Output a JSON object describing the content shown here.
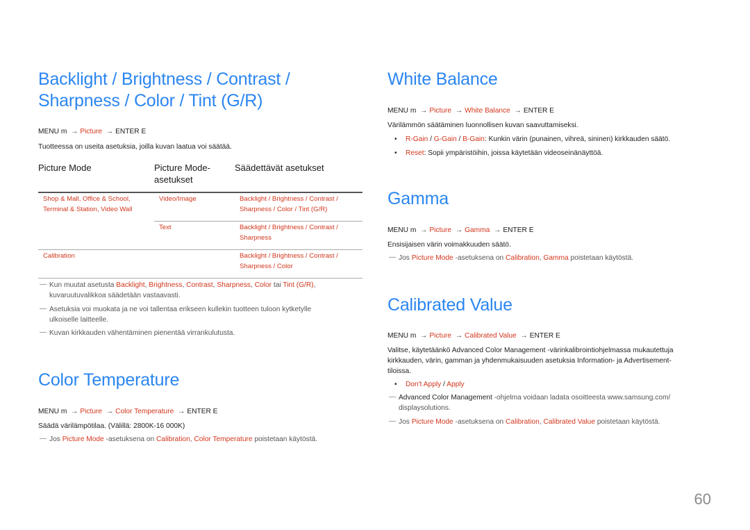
{
  "page_number": "60",
  "colors": {
    "heading": "#2b86f0",
    "accent": "#d2361c",
    "text": "#222222",
    "note": "#555555"
  },
  "left": {
    "backlight_section": {
      "title_line1": "Backlight / Brightness / Contrast /",
      "title_line2": "Sharpness / Color / Tint (G/R)",
      "menu": {
        "prefix": "MENU m",
        "items": [
          "Picture"
        ],
        "suffix": "ENTER E"
      },
      "description": "Tuotteessa on useita asetuksia, joilla kuvan laatua voi säätää.",
      "table": {
        "headers": [
          "Picture Mode",
          "Picture Mode-",
          "asetukset",
          "Säädettävät asetukset"
        ],
        "rows": [
          {
            "mode_line1": "Shop & Mall, Office & School,",
            "mode_line2": "Terminal & Station, Video Wall",
            "setting": "Video/Image",
            "adjust_line1": "Backlight / Brightness / Contrast /",
            "adjust_line2": "Sharpness / Color / Tint (G/R)"
          },
          {
            "mode_line1": "",
            "mode_line2": "",
            "setting": "Text",
            "adjust_line1": "Backlight / Brightness / Contrast /",
            "adjust_line2": "Sharpness"
          },
          {
            "mode_line1": "Calibration",
            "mode_line2": "",
            "setting": "",
            "adjust_line1": "Backlight / Brightness / Contrast /",
            "adjust_line2": "Sharpness / Color"
          }
        ]
      },
      "notes": [
        {
          "pre": "Kun muutat asetusta ",
          "terms": [
            "Backlight",
            "Brightness",
            "Contrast",
            "Sharpness",
            "Color"
          ],
          "mid": " tai ",
          "last": "Tint (G/R)",
          "post": ",",
          "line2": "kuvaruutuvalikkoa säädetään vastaavasti."
        },
        {
          "line1": "Asetuksia voi muokata ja ne voi tallentaa erikseen kullekin tuotteen tuloon kytketylle",
          "line2": "ulkoiselle laitteelle."
        },
        {
          "line1": "Kuvan kirkkauden vähentäminen pienentää virrankulutusta."
        }
      ]
    },
    "color_temperature": {
      "title": "Color Temperature",
      "menu": {
        "prefix": "MENU m",
        "items": [
          "Picture",
          "Color Temperature"
        ],
        "suffix": "ENTER E"
      },
      "description": "Säädä värilämpötilaa. (Välillä: 2800K-16 000K)",
      "note": {
        "pre": "Jos ",
        "term1": "Picture Mode",
        "mid": " -asetuksena on ",
        "term2": "Calibration",
        "comma": ", ",
        "term3": "Color Temperature",
        "post": " poistetaan käytöstä."
      }
    }
  },
  "right": {
    "white_balance": {
      "title": "White Balance",
      "menu": {
        "prefix": "MENU m",
        "items": [
          "Picture",
          "White Balance"
        ],
        "suffix": "ENTER E"
      },
      "description": "Värilämmön säätäminen luonnollisen kuvan saavuttamiseksi.",
      "bullets": [
        {
          "terms": [
            "R-Gain",
            "G-Gain",
            "B-Gain"
          ],
          "text": ": Kunkin värin (punainen, vihreä, sininen) kirkkauden säätö."
        },
        {
          "terms": [
            "Reset"
          ],
          "text": ": Sopii ympäristöihin, joissa käytetään videoseinänäyttöä."
        }
      ]
    },
    "gamma": {
      "title": "Gamma",
      "menu": {
        "prefix": "MENU m",
        "items": [
          "Picture",
          "Gamma"
        ],
        "suffix": "ENTER E"
      },
      "description": "Ensisijaisen värin voimakkuuden säätö.",
      "note": {
        "pre": "Jos ",
        "term1": "Picture Mode",
        "mid": " -asetuksena on ",
        "term2": "Calibration",
        "comma": ", ",
        "term3": "Gamma",
        "post": " poistetaan käytöstä."
      }
    },
    "calibrated_value": {
      "title": "Calibrated Value",
      "menu": {
        "prefix": "MENU m",
        "items": [
          "Picture",
          "Calibrated Value"
        ],
        "suffix": "ENTER E"
      },
      "desc_pre": "Valitse, käytetäänkö ",
      "desc_term": "Advanced Color Management",
      "desc_post": " -värinkalibrointiohjelmassa mukautettuja",
      "desc_line2": "kirkkauden, värin, gamman ja yhdenmukaisuuden asetuksia Information- ja Advertisement-",
      "desc_line3": "tiloissa.",
      "options": [
        "Don't Apply",
        "Apply"
      ],
      "note1": {
        "term": "Advanced Color Management",
        "line1": " -ohjelma voidaan ladata osoitteesta www.samsung.com/",
        "line2": "displaysolutions."
      },
      "note2": {
        "pre": "Jos ",
        "term1": "Picture Mode",
        "mid": " -asetuksena on ",
        "term2": "Calibration",
        "comma": ", ",
        "term3": "Calibrated Value",
        "post": " poistetaan käytöstä."
      }
    }
  }
}
